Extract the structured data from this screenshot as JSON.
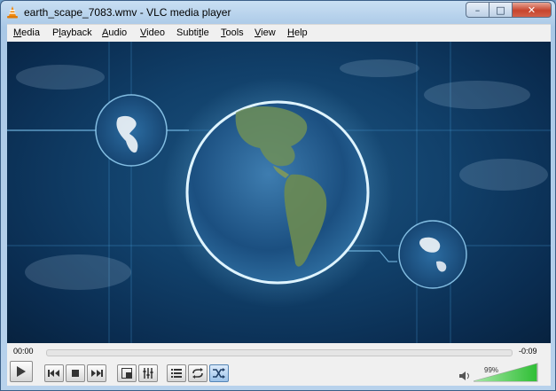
{
  "window": {
    "title": "earth_scape_7083.wmv - VLC media player",
    "controls": {
      "minimize": "–",
      "maximize": "□",
      "close": "✕"
    }
  },
  "menu": {
    "items": [
      "Media",
      "Playback",
      "Audio",
      "Video",
      "Subtitle",
      "Tools",
      "View",
      "Help"
    ]
  },
  "video": {
    "source": "earth_scape_7083.wmv"
  },
  "playback": {
    "elapsed": "00:00",
    "remaining": "-0:09",
    "progress_fraction": 0.0
  },
  "volume": {
    "label": "99%",
    "level_fraction": 0.99
  },
  "icons": [
    "vlc-cone-icon",
    "play-icon",
    "previous-icon",
    "stop-icon",
    "next-icon",
    "fullscreen-icon",
    "extended-settings-icon",
    "playlist-icon",
    "loop-icon",
    "random-icon",
    "speaker-icon"
  ],
  "colors": {
    "accent": "#2f7fcf",
    "volume_green": "#35c63a",
    "close_red": "#c7452e"
  }
}
